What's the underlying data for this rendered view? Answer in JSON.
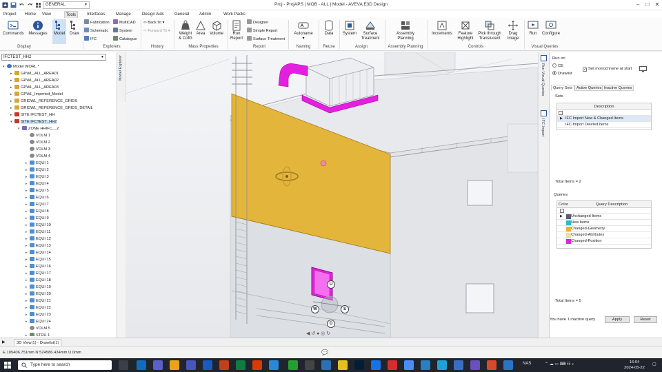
{
  "titlebar": {
    "workspace": "GENERAL",
    "title": "Proj - ProjAPS | MOB - ALL | Model - AVEVA E3D Design",
    "window_controls": [
      "minimize-icon",
      "maximize-icon",
      "close-icon"
    ]
  },
  "menu": {
    "tabs": [
      "Project",
      "Home",
      "Tools",
      "Interfaces",
      "Manage",
      "Design Aids",
      "General",
      "Admin",
      "Work Packs"
    ],
    "active": "Tools"
  },
  "ribbon": {
    "display": {
      "commands": "Commands",
      "messages": "Messages",
      "model": "Model",
      "draw": "Draw",
      "group": "Display"
    },
    "explorers": {
      "fabrication": "Fabrication",
      "schematic": "Schematic",
      "ifc": "IFC",
      "multicad": "MultiCAD",
      "system": "System",
      "catalogue": "Catalogue",
      "group": "Explorers"
    },
    "history": {
      "back": "Back To",
      "forward": "Forward To",
      "group": "History"
    },
    "mass": {
      "weight": "Weight",
      "weight2": "& CofG",
      "area": "Area",
      "volume": "Volume",
      "group": "Mass Properties"
    },
    "report": {
      "run": "Run",
      "run2": "Report",
      "designer": "Designer",
      "simple": "Simple Report",
      "surface": "Surface Treatment",
      "group": "Report"
    },
    "naming": {
      "autoname": "Autoname",
      "group": "Naming"
    },
    "reuse": {
      "data": "Data",
      "group": "Reuse"
    },
    "assign": {
      "system": "System",
      "surface": "Surface",
      "surface2": "Treatment",
      "group": "Assign"
    },
    "assembly": {
      "label": "Assembly",
      "label2": "Planning",
      "group": "Assembly Planning"
    },
    "controls": {
      "increments": "Increments",
      "feature": "Feature",
      "feature2": "Highlight",
      "pick": "Pick through",
      "pick2": "Translucent",
      "drag": "Drag",
      "drag2": "Image",
      "group": "Controls"
    },
    "visual": {
      "run": "Run",
      "configure": "Configure",
      "group": "Visual Queries"
    }
  },
  "explorer": {
    "filter": "IFCTEST_HH2",
    "side_label": "Model Explorer",
    "tree": [
      {
        "label": "Model WORL *",
        "indent": 0,
        "toggle": "-",
        "icon": "globe"
      },
      {
        "label": "GPWL_ALL_AREA01",
        "indent": 1,
        "toggle": "+",
        "icon": "folder"
      },
      {
        "label": "GPWL_ALL_AREA02",
        "indent": 1,
        "toggle": "+",
        "icon": "folder"
      },
      {
        "label": "GPWL_ALL_AREA03",
        "indent": 1,
        "toggle": "+",
        "icon": "folder"
      },
      {
        "label": "GPWL_Imported_Model",
        "indent": 1,
        "toggle": "+",
        "icon": "folder"
      },
      {
        "label": "GRIDWL_REFERENCE_GRIDS",
        "indent": 1,
        "toggle": "+",
        "icon": "folder"
      },
      {
        "label": "GRIDWL_REFERENCE_GRIDS_DETAIL",
        "indent": 1,
        "toggle": "+",
        "icon": "folder"
      },
      {
        "label": "SITE IFCTEST_HH",
        "indent": 1,
        "toggle": "+",
        "icon": "site"
      },
      {
        "label": "SITE IFCTEST_HH2",
        "indent": 1,
        "toggle": "-",
        "icon": "site",
        "selected": true
      },
      {
        "label": "ZONE HHIFC__2",
        "indent": 2,
        "toggle": "-",
        "icon": "zone"
      },
      {
        "label": "VOLM 1",
        "indent": 3,
        "toggle": "",
        "icon": "volm"
      },
      {
        "label": "VOLM 2",
        "indent": 3,
        "toggle": "",
        "icon": "volm"
      },
      {
        "label": "VOLM 3",
        "indent": 3,
        "toggle": "",
        "icon": "volm"
      },
      {
        "label": "VOLM 4",
        "indent": 3,
        "toggle": "",
        "icon": "volm"
      },
      {
        "label": "EQUI 1",
        "indent": 3,
        "toggle": "+",
        "icon": "equi"
      },
      {
        "label": "EQUI 2",
        "indent": 3,
        "toggle": "+",
        "icon": "equi"
      },
      {
        "label": "EQUI 3",
        "indent": 3,
        "toggle": "+",
        "icon": "equi"
      },
      {
        "label": "EQUI 4",
        "indent": 3,
        "toggle": "+",
        "icon": "equi"
      },
      {
        "label": "EQUI 5",
        "indent": 3,
        "toggle": "+",
        "icon": "equi"
      },
      {
        "label": "EQUI 6",
        "indent": 3,
        "toggle": "+",
        "icon": "equi"
      },
      {
        "label": "EQUI 7",
        "indent": 3,
        "toggle": "+",
        "icon": "equi"
      },
      {
        "label": "EQUI 8",
        "indent": 3,
        "toggle": "+",
        "icon": "equi"
      },
      {
        "label": "EQUI 9",
        "indent": 3,
        "toggle": "+",
        "icon": "equi"
      },
      {
        "label": "EQUI 10",
        "indent": 3,
        "toggle": "+",
        "icon": "equi"
      },
      {
        "label": "EQUI 11",
        "indent": 3,
        "toggle": "+",
        "icon": "equi"
      },
      {
        "label": "EQUI 12",
        "indent": 3,
        "toggle": "+",
        "icon": "equi"
      },
      {
        "label": "EQUI 13",
        "indent": 3,
        "toggle": "+",
        "icon": "equi"
      },
      {
        "label": "EQUI 14",
        "indent": 3,
        "toggle": "+",
        "icon": "equi"
      },
      {
        "label": "EQUI 15",
        "indent": 3,
        "toggle": "+",
        "icon": "equi"
      },
      {
        "label": "EQUI 16",
        "indent": 3,
        "toggle": "+",
        "icon": "equi"
      },
      {
        "label": "EQUI 17",
        "indent": 3,
        "toggle": "+",
        "icon": "equi"
      },
      {
        "label": "EQUI 18",
        "indent": 3,
        "toggle": "+",
        "icon": "equi"
      },
      {
        "label": "EQUI 19",
        "indent": 3,
        "toggle": "+",
        "icon": "equi"
      },
      {
        "label": "EQUI 20",
        "indent": 3,
        "toggle": "+",
        "icon": "equi"
      },
      {
        "label": "EQUI 21",
        "indent": 3,
        "toggle": "+",
        "icon": "equi"
      },
      {
        "label": "EQUI 22",
        "indent": 3,
        "toggle": "+",
        "icon": "equi"
      },
      {
        "label": "EQUI 23",
        "indent": 3,
        "toggle": "+",
        "icon": "equi"
      },
      {
        "label": "EQUI 24",
        "indent": 3,
        "toggle": "+",
        "icon": "equi"
      },
      {
        "label": "VOLM 5",
        "indent": 3,
        "toggle": "",
        "icon": "volm"
      },
      {
        "label": "STRU 1",
        "indent": 3,
        "toggle": "+",
        "icon": "stru"
      }
    ]
  },
  "viewport": {
    "gizmo_labels": {
      "up": "U",
      "west": "W",
      "south": "S",
      "down": "D"
    }
  },
  "right_tabs": [
    "Run Visual Queries",
    "IFC Import"
  ],
  "panel": {
    "run_on": "Run on",
    "ce": "CE",
    "drawlist": "Drawlist",
    "monochrome": "Set monochrome at start",
    "tabs": [
      "Query Sets",
      "Active Queries",
      "Inactive Queries"
    ],
    "sets_label": "Sets",
    "sets_header": "Description",
    "sets": [
      {
        "label": "IFC Import New & Changed Items",
        "selected": true
      },
      {
        "label": "IFC Import Deleted Items",
        "selected": false
      }
    ],
    "sets_total": "Total Items = 2",
    "queries_label": "Queries",
    "queries_header_color": "Color",
    "queries_header_desc": "Query Description",
    "queries": [
      {
        "label": "Unchanged-Items",
        "color": "#5b5d70",
        "selected": true
      },
      {
        "label": "New Items",
        "color": "#2eb8c8",
        "selected": false
      },
      {
        "label": "Changed-Geometry",
        "color": "#e4b43a",
        "selected": false
      },
      {
        "label": "Changed-Attributes",
        "color": "#e2e2a8",
        "selected": false
      },
      {
        "label": "Changed-Position",
        "color": "#e51fe0",
        "selected": false
      }
    ],
    "queries_total": "Total Items = 5",
    "inactive_msg": "You have 1 inactive query",
    "apply": "Apply",
    "reset": "Reset"
  },
  "viewtab": "3D View(1) - Drawlist(1)",
  "status": {
    "coords": "E 105406.751mm N 524586.434mm U 0mm"
  },
  "taskbar": {
    "search_placeholder": "Type here to search",
    "tray_app": "NAS",
    "time": "16:04",
    "date": "2024-05-22"
  },
  "colors": {
    "accent": "#2b579a",
    "panel_yellow": "#e3b53b",
    "magenta": "#e51fe0",
    "taskbar": "#20252d"
  }
}
